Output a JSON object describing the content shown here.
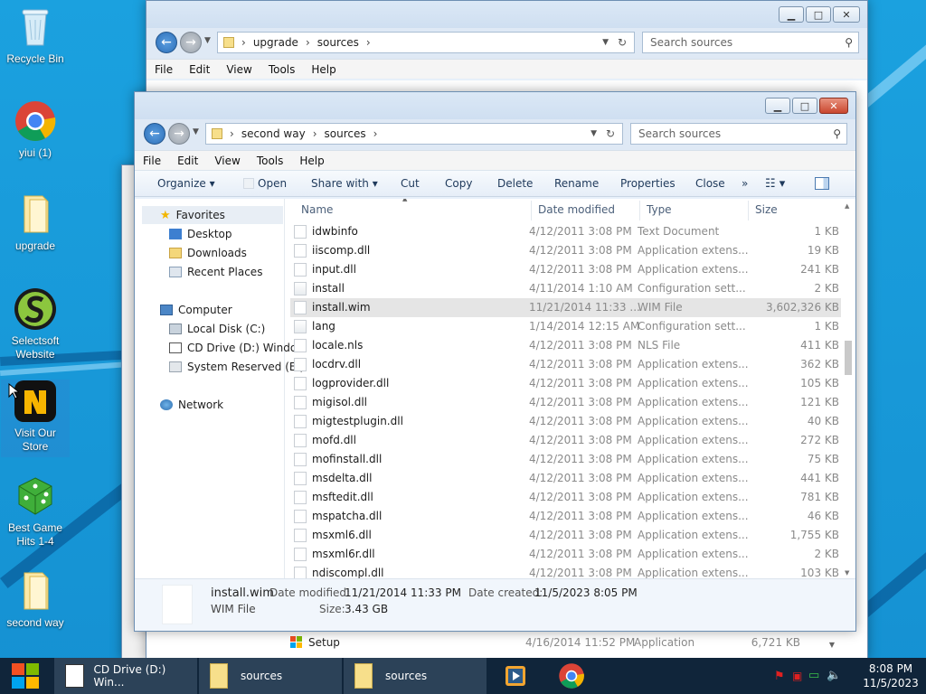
{
  "desktop": {
    "icons": [
      {
        "label": "Recycle Bin",
        "icon": "recycle-bin-icon"
      },
      {
        "label": "yiui (1)",
        "icon": "chrome-icon"
      },
      {
        "label": "upgrade",
        "icon": "folder-icon"
      },
      {
        "label": "Selectsoft Website",
        "icon": "selectsoft-icon"
      },
      {
        "label": "Visit Our Store",
        "icon": "store-icon"
      },
      {
        "label": "Best Game Hits 1-4",
        "icon": "dice-icon"
      },
      {
        "label": "second way",
        "icon": "folder-icon"
      }
    ]
  },
  "window_back": {
    "path": [
      "upgrade",
      "sources"
    ],
    "search_placeholder": "Search sources",
    "menu": [
      "File",
      "Edit",
      "View",
      "Tools",
      "Help"
    ],
    "bottom_row": {
      "name": "Setup",
      "date": "4/16/2014 11:52 PM",
      "type": "Application",
      "size": "6,721 KB"
    }
  },
  "window_front": {
    "path": [
      "second way",
      "sources"
    ],
    "search_placeholder": "Search sources",
    "menu": [
      "File",
      "Edit",
      "View",
      "Tools",
      "Help"
    ],
    "toolbar": {
      "organize": "Organize",
      "open": "Open",
      "share_with": "Share with",
      "cut": "Cut",
      "copy": "Copy",
      "delete": "Delete",
      "rename": "Rename",
      "properties": "Properties",
      "close": "Close",
      "more": "»"
    },
    "nav": {
      "favorites": "Favorites",
      "desktop": "Desktop",
      "downloads": "Downloads",
      "recent": "Recent Places",
      "computer": "Computer",
      "local_disk": "Local Disk (C:)",
      "cd_drive": "CD Drive (D:) Windo",
      "system_reserved": "System Reserved (E:)",
      "network": "Network"
    },
    "columns": {
      "name": "Name",
      "date": "Date modified",
      "type": "Type",
      "size": "Size"
    },
    "files": [
      {
        "name": "idwbinfo",
        "date": "4/12/2011 3:08 PM",
        "type": "Text Document",
        "size": "1 KB"
      },
      {
        "name": "iiscomp.dll",
        "date": "4/12/2011 3:08 PM",
        "type": "Application extens...",
        "size": "19 KB"
      },
      {
        "name": "input.dll",
        "date": "4/12/2011 3:08 PM",
        "type": "Application extens...",
        "size": "241 KB"
      },
      {
        "name": "install",
        "date": "4/11/2014 1:10 AM",
        "type": "Configuration sett...",
        "size": "2 KB"
      },
      {
        "name": "install.wim",
        "date": "11/21/2014 11:33 ...",
        "type": "WIM File",
        "size": "3,602,326 KB"
      },
      {
        "name": "lang",
        "date": "1/14/2014 12:15 AM",
        "type": "Configuration sett...",
        "size": "1 KB"
      },
      {
        "name": "locale.nls",
        "date": "4/12/2011 3:08 PM",
        "type": "NLS File",
        "size": "411 KB"
      },
      {
        "name": "locdrv.dll",
        "date": "4/12/2011 3:08 PM",
        "type": "Application extens...",
        "size": "362 KB"
      },
      {
        "name": "logprovider.dll",
        "date": "4/12/2011 3:08 PM",
        "type": "Application extens...",
        "size": "105 KB"
      },
      {
        "name": "migisol.dll",
        "date": "4/12/2011 3:08 PM",
        "type": "Application extens...",
        "size": "121 KB"
      },
      {
        "name": "migtestplugin.dll",
        "date": "4/12/2011 3:08 PM",
        "type": "Application extens...",
        "size": "40 KB"
      },
      {
        "name": "mofd.dll",
        "date": "4/12/2011 3:08 PM",
        "type": "Application extens...",
        "size": "272 KB"
      },
      {
        "name": "mofinstall.dll",
        "date": "4/12/2011 3:08 PM",
        "type": "Application extens...",
        "size": "75 KB"
      },
      {
        "name": "msdelta.dll",
        "date": "4/12/2011 3:08 PM",
        "type": "Application extens...",
        "size": "441 KB"
      },
      {
        "name": "msftedit.dll",
        "date": "4/12/2011 3:08 PM",
        "type": "Application extens...",
        "size": "781 KB"
      },
      {
        "name": "mspatcha.dll",
        "date": "4/12/2011 3:08 PM",
        "type": "Application extens...",
        "size": "46 KB"
      },
      {
        "name": "msxml6.dll",
        "date": "4/12/2011 3:08 PM",
        "type": "Application extens...",
        "size": "1,755 KB"
      },
      {
        "name": "msxml6r.dll",
        "date": "4/12/2011 3:08 PM",
        "type": "Application extens...",
        "size": "2 KB"
      },
      {
        "name": "ndiscompl.dll",
        "date": "4/12/2011 3:08 PM",
        "type": "Application extens...",
        "size": "103 KB"
      }
    ],
    "selected_index": 4,
    "details": {
      "name": "install.wim",
      "type": "WIM File",
      "modified_label": "Date modified:",
      "modified": "11/21/2014 11:33 PM",
      "created_label": "Date created:",
      "created": "11/5/2023 8:05 PM",
      "size_label": "Size:",
      "size": "3.43 GB"
    }
  },
  "taskbar": {
    "tasks": [
      {
        "label": "CD Drive (D:) Win...",
        "icon": "cd-drive-icon"
      },
      {
        "label": "sources",
        "icon": "folder-icon"
      },
      {
        "label": "sources",
        "icon": "folder-icon"
      }
    ],
    "time": "8:08 PM",
    "date": "11/5/2023"
  }
}
